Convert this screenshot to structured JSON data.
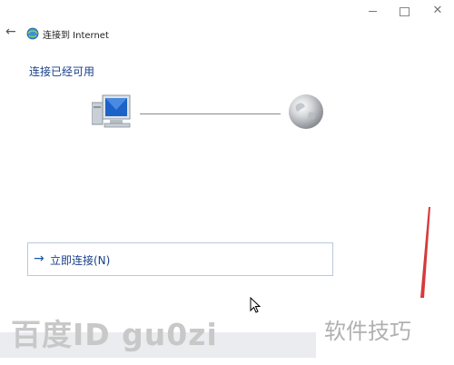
{
  "window": {
    "minimize_icon": "minimize-icon",
    "maximize_icon": "maximize-icon",
    "close_icon": "close-icon",
    "close_glyph": "✕"
  },
  "nav": {
    "back_glyph": "←",
    "title": "连接到 Internet"
  },
  "main": {
    "heading": "连接已经可用",
    "diagram": {
      "left_icon": "computer-icon",
      "right_icon": "globe-icon"
    },
    "action": {
      "arrow_glyph": "→",
      "label": "立即连接(N)"
    }
  },
  "watermark": {
    "left": "百度ID gu0zi",
    "right": "软件技巧"
  },
  "colors": {
    "accent": "#1a3f8a",
    "link_arrow": "#1a56a8",
    "box_border": "#b9c9de",
    "red_mark": "#d63a3a"
  }
}
